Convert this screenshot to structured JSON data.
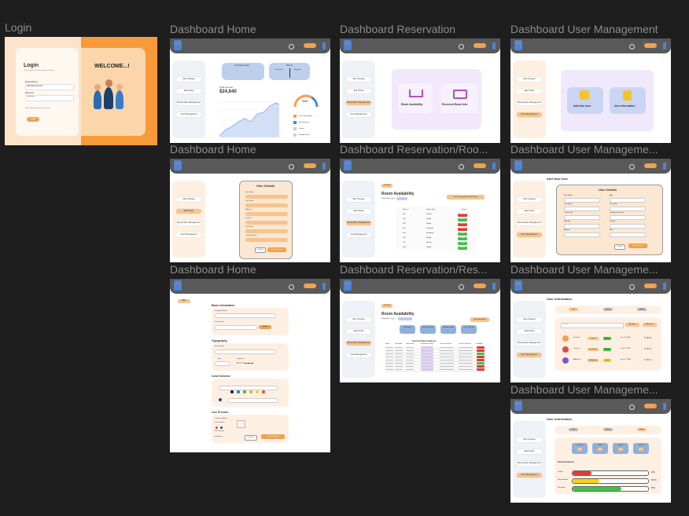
{
  "frames": {
    "login": {
      "label": "Login",
      "title": "Login",
      "subtitle": "Please register the following input and login",
      "email_label": "Email Address",
      "email_value": "admin@gmail.com",
      "password_label": "Password",
      "password_value": "**********",
      "forgot": "Don't have an account?",
      "signup": "Sign up",
      "login_button": "Login",
      "welcome": "WELCOME...!"
    },
    "home": {
      "label": "Dashboard Home",
      "card1_title": "Total Reservation",
      "card2_title": "Rooms",
      "card2_a": "Reserved",
      "card2_b": "Available",
      "income_label": "Total Income",
      "income_value": "$24,640",
      "staff_label": "Staff",
      "legend": [
        "Front Desk Agent",
        "Housekeeper",
        "Janitor",
        "Bell Attendant"
      ]
    },
    "reservation": {
      "label": "Dashboard Reservation",
      "card_a": "Room Availability",
      "card_b": "Reserved Room Info."
    },
    "usermgmt": {
      "label": "Dashboard User Management",
      "card_a": "Add New User",
      "card_b": "User Information"
    },
    "home2": {
      "label": "Dashboard Home",
      "panel_title": "User Details",
      "fields": [
        "First Name",
        "Last Name",
        "Address",
        "Contact",
        "Password",
        "Change Profile"
      ],
      "cancel": "Cancel",
      "save": "Save Changes"
    },
    "resroom": {
      "label": "Dashboard Reservation/Roo...",
      "back": "Go Back",
      "title": "Room Availability",
      "filter": "Room/Floor Type",
      "btn": "View Reserved Room Info/Details",
      "headers": [
        "Room #",
        "Room Type",
        "Status"
      ],
      "rows": [
        [
          "101",
          "Deluxe",
          "Reserved"
        ],
        [
          "102",
          "Single",
          "Vacant"
        ],
        [
          "103",
          "Single",
          "Reserved"
        ],
        [
          "104",
          "Standard",
          "Reserved"
        ],
        [
          "105",
          "Standard",
          "Vacant"
        ],
        [
          "106",
          "Single",
          "Vacant"
        ],
        [
          "107",
          "Deluxe",
          "Vacant"
        ],
        [
          "108",
          "Single",
          "Vacant"
        ]
      ]
    },
    "usernew": {
      "label": "Dashboard User Manageme...",
      "title": "Add New User",
      "panel_title": "User Details",
      "fields": [
        "First Name",
        "Age",
        "Last Name",
        "Password",
        "Contact No.",
        "Confirm Password",
        "Birthday",
        "Gender",
        "Address",
        "Role"
      ],
      "cancel": "Cancel",
      "save": "Save Changes"
    },
    "settings": {
      "label": "Dashboard Home",
      "back": "Back",
      "basic": "Basic Information",
      "company": "Company Name",
      "favicon": "Favicon/Icon",
      "upload": "Upload",
      "typography": "Typography",
      "font_family": "Font Family",
      "size": "Size",
      "properties": "properties",
      "color": "Color Scheme",
      "live": "Live Preview",
      "cancel": "Cancel",
      "save": "Save Changes",
      "swatches": [
        "#1a1a1a",
        "#2f6fe0",
        "#3bb54a",
        "#f0a24e",
        "#e8d13a",
        "#e34a4a"
      ]
    },
    "resres": {
      "label": "Dashboard Reservation/Res...",
      "back": "Go Back",
      "title": "Room Availability",
      "filter": "Room/Floor Type",
      "btn": "Room Availability",
      "stats": [
        "Total Rooms",
        "Reserved Rooms",
        "Available Rooms",
        "Total Check-ins"
      ],
      "table_title": "Current Reservations",
      "headers": [
        "Room #",
        "Guest Name",
        "Check-In Day",
        "Reservation Package",
        "Check-in Date/Time",
        "Check-out Date/Time",
        "Availability"
      ]
    },
    "userinfo": {
      "label": "Dashboard User Manageme...",
      "title": "User Information",
      "tabs": [
        "Staff",
        "Guests",
        "Admin"
      ],
      "search": "Search",
      "btn_a": "All Roles",
      "btn_b": "All Status",
      "users": [
        [
          "Frank Dr.",
          "Janitor",
          "Active",
          "Jan 11, 2024"
        ],
        [
          "Jane Lin",
          "Housekeeper",
          "Active",
          "Jan 13, 2024"
        ],
        [
          "Albert Fo.",
          "Bell Attendant",
          "Inactive",
          "Jan 17, 2024"
        ]
      ]
    },
    "userstats": {
      "label": "Dashboard User Manageme...",
      "title": "User Information",
      "tabs": [
        "Staff",
        "Guests",
        "Admin"
      ],
      "stats": [
        "Total Users",
        "Active",
        "Inactive",
        "Admins"
      ],
      "section": "Role Distribution",
      "bars": [
        {
          "name": "Janitor",
          "value": 25,
          "color": "#e53935"
        },
        {
          "name": "Housekeeper",
          "value": 35,
          "color": "#f5d21a"
        },
        {
          "name": "Reception",
          "value": 65,
          "color": "#43c04a"
        }
      ],
      "bar_labels": [
        "25%",
        "35.5%",
        "65%"
      ]
    },
    "sidebar": [
      "Site Changes",
      "Edit Profile",
      "Reservation Management",
      "User Management"
    ]
  }
}
